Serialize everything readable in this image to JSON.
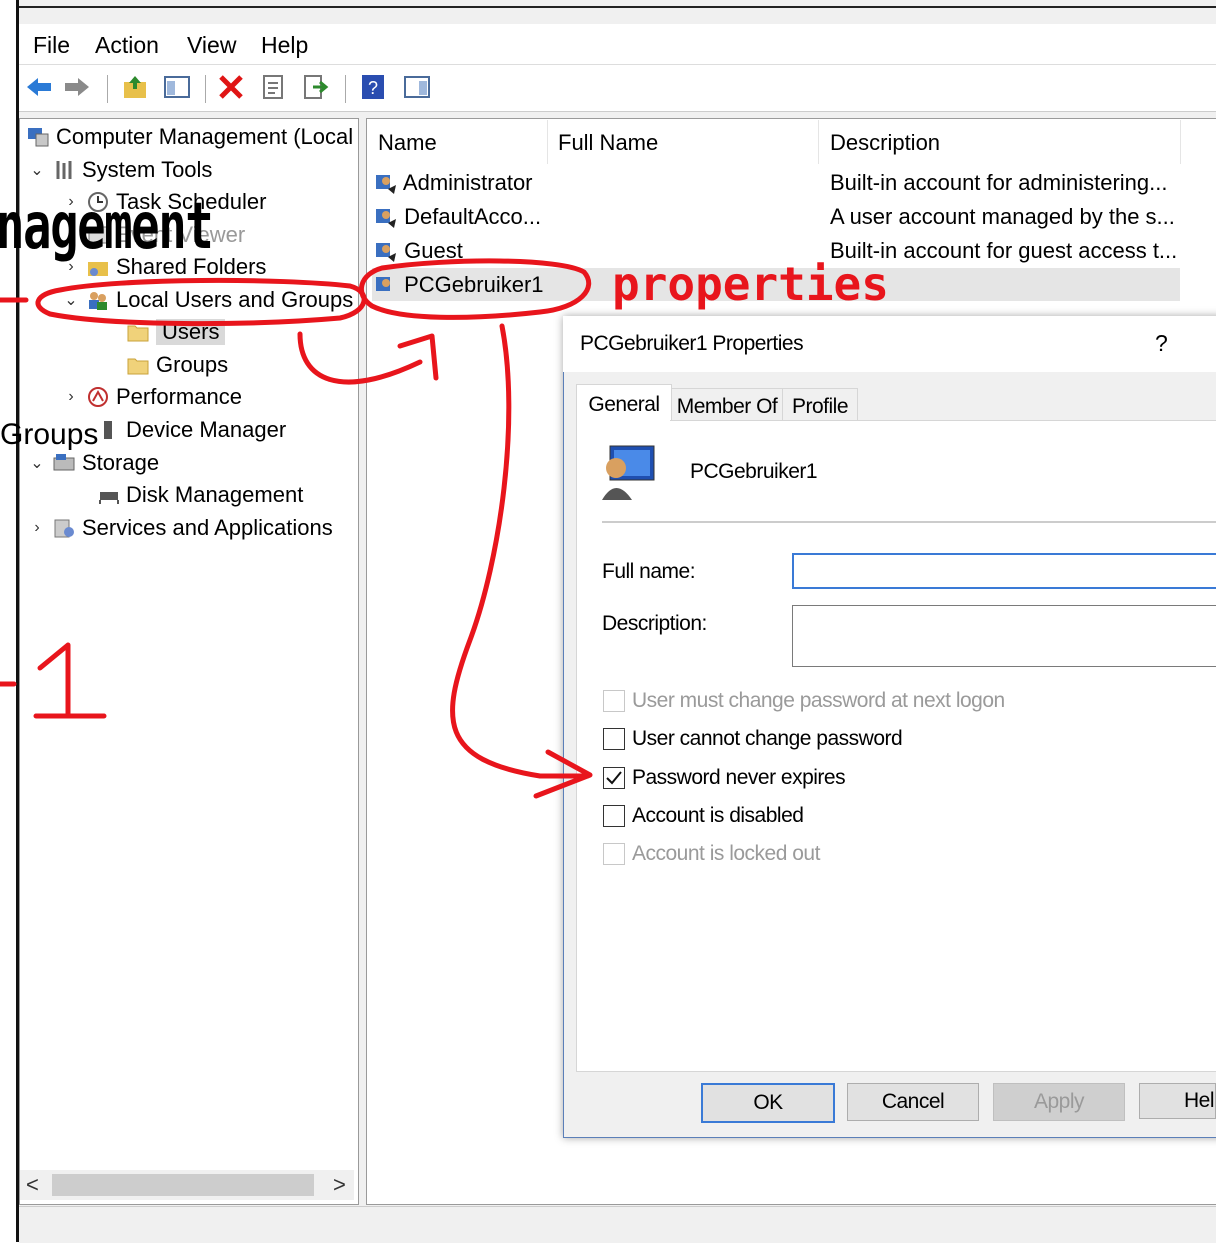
{
  "menu": [
    "File",
    "Action",
    "View",
    "Help"
  ],
  "tree": {
    "root": "Computer Management (Local",
    "system_tools": "System Tools",
    "task_scheduler": "Task Scheduler",
    "event_viewer": "Event Viewer",
    "shared_folders": "Shared Folders",
    "local_users_groups": "Local Users and Groups",
    "users": "Users",
    "groups": "Groups",
    "performance": "Performance",
    "device_manager": "Device Manager",
    "storage": "Storage",
    "disk_management": "Disk Management",
    "services_apps": "Services and Applications",
    "scroll_left": "<",
    "scroll_right": ">"
  },
  "list": {
    "columns": [
      "Name",
      "Full Name",
      "Description"
    ],
    "rows": [
      {
        "name": "Administrator",
        "full_name": "",
        "description": "Built-in account for administering..."
      },
      {
        "name": "DefaultAcco...",
        "full_name": "",
        "description": "A user account managed by the s..."
      },
      {
        "name": "Guest",
        "full_name": "",
        "description": "Built-in account for guest access t..."
      },
      {
        "name": "PCGebruiker1",
        "full_name": "",
        "description": ""
      }
    ]
  },
  "dialog": {
    "title": "PCGebruiker1 Properties",
    "help_glyph": "?",
    "tabs": [
      "General",
      "Member Of",
      "Profile"
    ],
    "username": "PCGebruiker1",
    "full_name_label": "Full name:",
    "full_name_value": "",
    "description_label": "Description:",
    "description_value": "",
    "checkboxes": [
      {
        "label": "User must change password at next logon",
        "checked": false,
        "disabled": true
      },
      {
        "label": "User cannot change password",
        "checked": false,
        "disabled": false
      },
      {
        "label": "Password never expires",
        "checked": true,
        "disabled": false
      },
      {
        "label": "Account is disabled",
        "checked": false,
        "disabled": false
      },
      {
        "label": "Account is locked out",
        "checked": false,
        "disabled": true
      }
    ],
    "buttons": [
      "OK",
      "Cancel",
      "Apply",
      "Help"
    ]
  },
  "annotations": {
    "overlay_title": "nagement",
    "overlay_groups": "Groups",
    "properties_note": "properties",
    "step_number": "1",
    "ink_color": "#e8151c"
  }
}
